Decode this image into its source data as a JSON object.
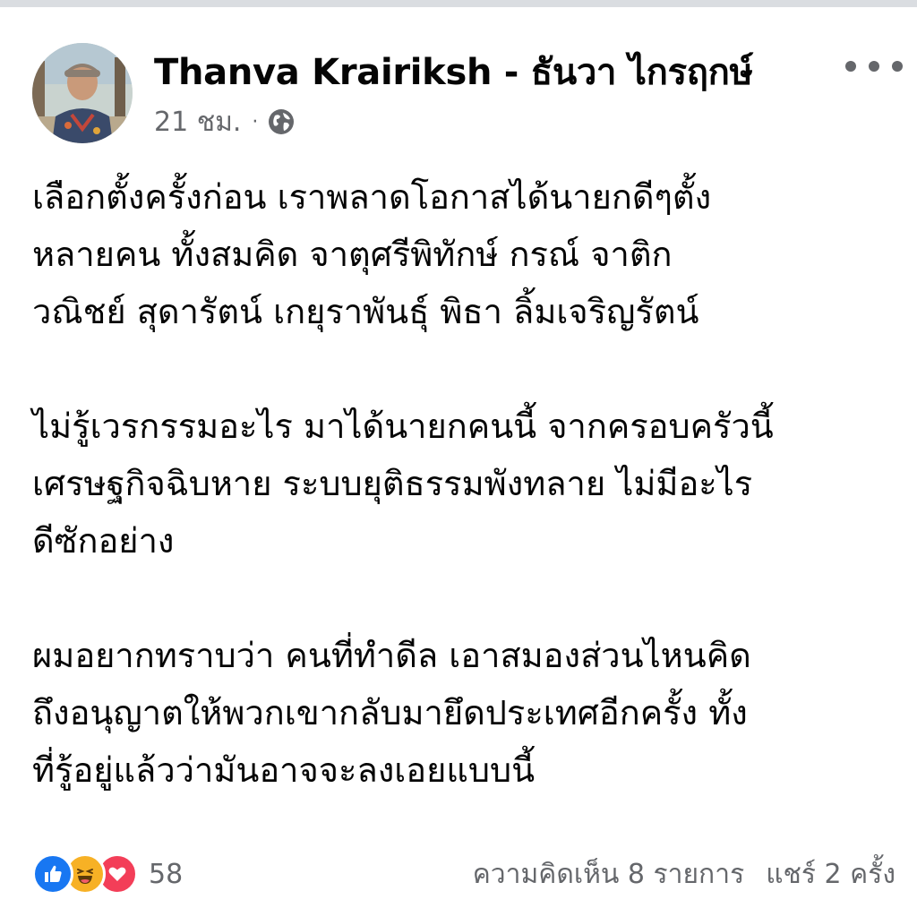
{
  "post": {
    "author": "Thanva Krairiksh - ธันวา ไกรฤกษ์",
    "time": "21 ชม.",
    "separator": "·",
    "privacy_icon": "globe-icon",
    "more_icon": "more-options-icon",
    "paragraphs": [
      {
        "lines": [
          "เลือกตั้งครั้งก่อน เราพลาดโอกาสได้นายกดีๆตั้ง",
          "หลายคน ทั้งสมคิด จาตุศรีพิทักษ์ กรณ์ จาติก",
          "วณิชย์ สุดารัตน์ เกยุราพันธุ์ พิธา ลิ้มเจริญรัตน์"
        ]
      },
      {
        "lines": [
          "ไม่รู้เวรกรรมอะไร มาได้นายกคนนี้ จากครอบครัวนี้",
          "เศรษฐกิจฉิบหาย ระบบยุติธรรมพังทลาย ไม่มีอะไร",
          "ดีซักอย่าง"
        ]
      },
      {
        "lines": [
          "ผมอยากทราบว่า คนที่ทำดีล เอาสมองส่วนไหนคิด",
          "ถึงอนุญาตให้พวกเขากลับมายึดประเทศอีกครั้ง ทั้ง",
          "ที่รู้อยู่แล้วว่ามันอาจจะลงเอยแบบนี้"
        ]
      }
    ],
    "reactions": {
      "types": [
        "like",
        "haha",
        "love"
      ],
      "count": "58"
    },
    "comments_label": "ความคิดเห็น 8 รายการ",
    "shares_label": "แชร์ 2 ครั้ง"
  },
  "colors": {
    "like": "#1877f2",
    "haha": "#f7b125",
    "love": "#f33e58",
    "secondary_text": "#65676b"
  }
}
